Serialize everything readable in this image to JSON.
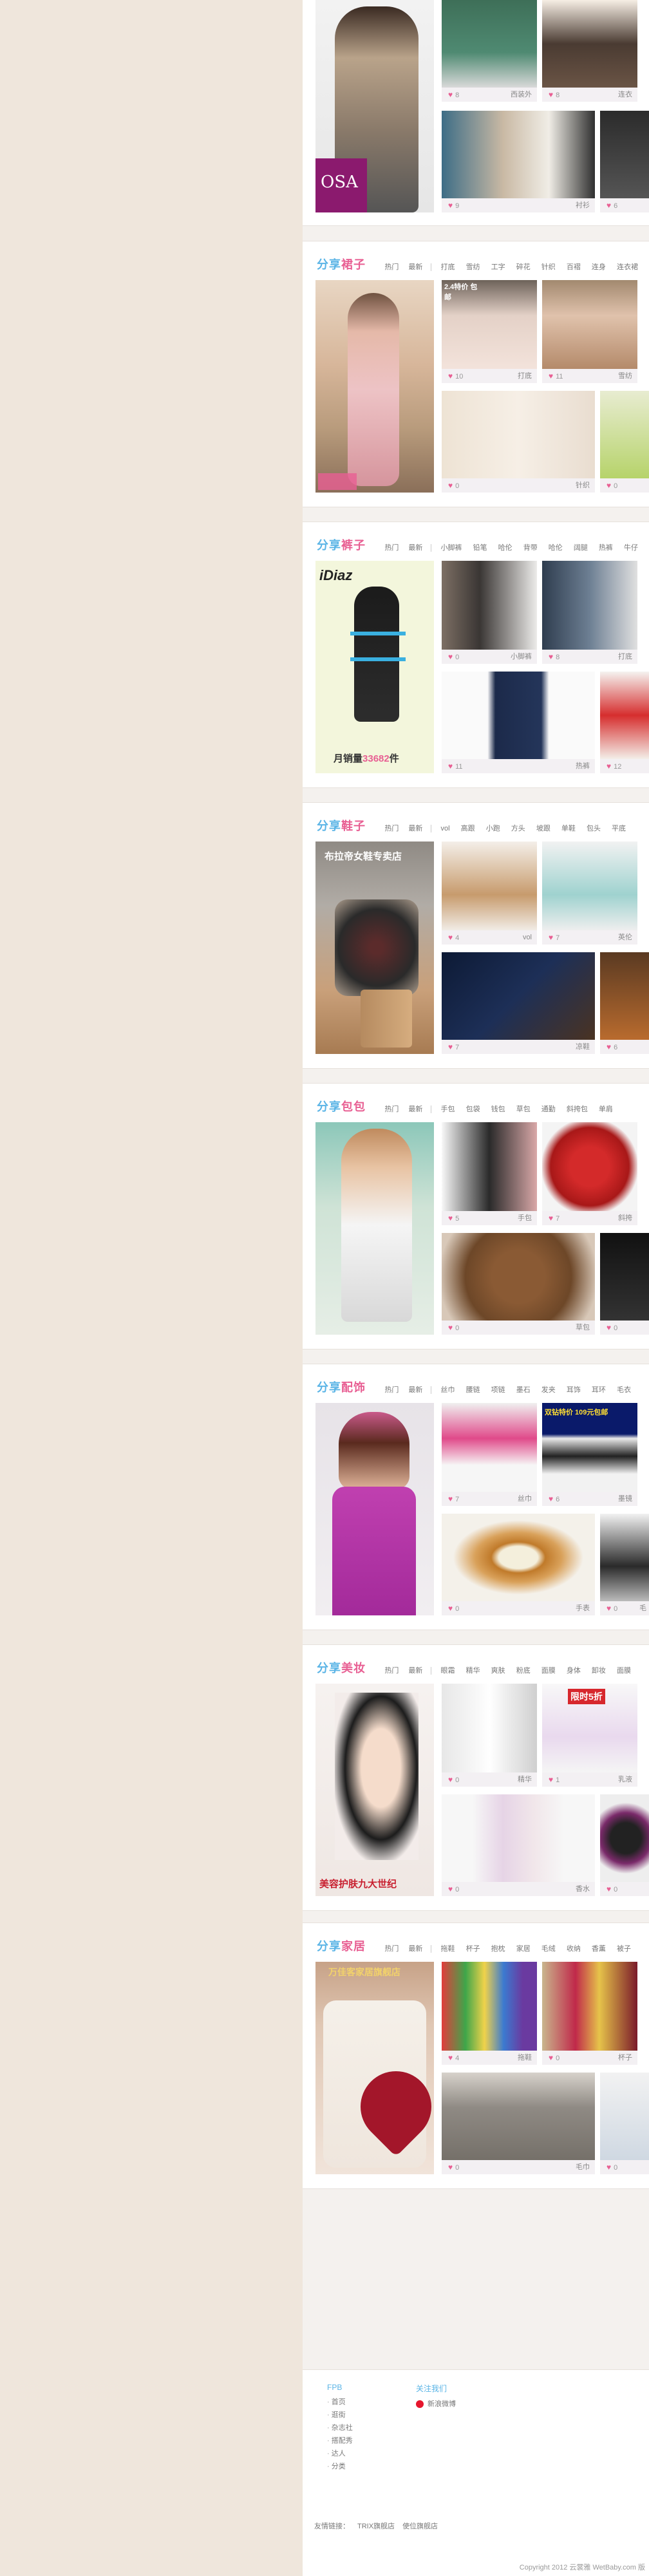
{
  "sections": [
    {
      "key": "top",
      "tiles": [
        {
          "count": "8",
          "tag": "西装外"
        },
        {
          "count": "8",
          "tag": "连衣"
        },
        {
          "count": "9",
          "tag": "衬衫"
        },
        {
          "count": "6",
          "tag": ""
        }
      ],
      "big_label": "OSA"
    },
    {
      "key": "skirt",
      "prefix": "分享",
      "category": "裙子",
      "tabs": [
        "热门",
        "最新"
      ],
      "sub": [
        "打底",
        "雪纺",
        "工字",
        "碎花",
        "针织",
        "百褶",
        "连身",
        "连衣裙"
      ],
      "promo": "2.4特价 包邮",
      "tiles": [
        {
          "count": "10",
          "tag": "打底"
        },
        {
          "count": "11",
          "tag": "雪纺"
        },
        {
          "count": "0",
          "tag": "针织"
        },
        {
          "count": "0",
          "tag": ""
        }
      ],
      "big_label": ""
    },
    {
      "key": "pants",
      "prefix": "分享",
      "category": "裤子",
      "tabs": [
        "热门",
        "最新"
      ],
      "sub": [
        "小脚裤",
        "铅笔",
        "哈伦",
        "背带",
        "哈伦",
        "阔腿",
        "热裤",
        "牛仔"
      ],
      "tiles": [
        {
          "count": "0",
          "tag": "小脚裤"
        },
        {
          "count": "8",
          "tag": "打底"
        },
        {
          "count": "11",
          "tag": "连衣"
        },
        {
          "count": "12",
          "tag": "热裤"
        }
      ],
      "big_brand": "iDiaz",
      "big_sales_prefix": "月销量",
      "big_sales_num": "33682",
      "big_sales_suffix": "件"
    },
    {
      "key": "shoes",
      "prefix": "分享",
      "category": "鞋子",
      "tabs": [
        "热门",
        "最新"
      ],
      "sub": [
        "vol",
        "高跟",
        "小跑",
        "方头",
        "坡跟",
        "单鞋",
        "包头",
        "平底"
      ],
      "promo": "布拉帝女鞋专卖店",
      "tiles": [
        {
          "count": "4",
          "tag": "vol"
        },
        {
          "count": "7",
          "tag": "英伦"
        },
        {
          "count": "7",
          "tag": "凉鞋"
        },
        {
          "count": "6",
          "tag": ""
        }
      ]
    },
    {
      "key": "bags",
      "prefix": "分享",
      "category": "包包",
      "tabs": [
        "热门",
        "最新"
      ],
      "sub": [
        "手包",
        "包袋",
        "钱包",
        "草包",
        "通勤",
        "斜挎包",
        "单肩"
      ],
      "tiles": [
        {
          "count": "5",
          "tag": "手包"
        },
        {
          "count": "7",
          "tag": "斜挎"
        },
        {
          "count": "0",
          "tag": "草包"
        },
        {
          "count": "0",
          "tag": ""
        }
      ]
    },
    {
      "key": "accessories",
      "prefix": "分享",
      "category": "配饰",
      "tabs": [
        "热门",
        "最新"
      ],
      "sub": [
        "丝巾",
        "腰链",
        "项链",
        "墨石",
        "发夹",
        "耳饰",
        "耳环",
        "毛衣"
      ],
      "promo": "双钻特价 109元包邮",
      "tiles": [
        {
          "count": "7",
          "tag": "丝巾"
        },
        {
          "count": "6",
          "tag": "墨镜"
        },
        {
          "count": "0",
          "tag": "手表"
        },
        {
          "count": "0",
          "tag": "毛"
        }
      ]
    },
    {
      "key": "beauty",
      "prefix": "分享",
      "category": "美妆",
      "tabs": [
        "热门",
        "最新"
      ],
      "sub": [
        "眼霜",
        "精华",
        "爽肤",
        "粉底",
        "面膜",
        "身体",
        "卸妆",
        "面膜",
        "彩妆"
      ],
      "promo": "限时5折",
      "tiles": [
        {
          "count": "0",
          "tag": "精华"
        },
        {
          "count": "1",
          "tag": "乳液"
        },
        {
          "count": "0",
          "tag": "香水"
        },
        {
          "count": "0",
          "tag": ""
        }
      ],
      "big_caption": "美容护肤九大世纪"
    },
    {
      "key": "home",
      "prefix": "分享",
      "category": "家居",
      "tabs": [
        "热门",
        "最新"
      ],
      "sub": [
        "拖鞋",
        "杯子",
        "抱枕",
        "家居",
        "毛绒",
        "收纳",
        "香薰",
        "被子"
      ],
      "promo": "万佳客家居旗舰店",
      "tiles": [
        {
          "count": "4",
          "tag": "拖鞋"
        },
        {
          "count": "0",
          "tag": "杯子"
        },
        {
          "count": "0",
          "tag": "毛巾"
        },
        {
          "count": "0",
          "tag": ""
        }
      ]
    }
  ],
  "footer": {
    "col1_title": "FPB",
    "col1_items": [
      "首页",
      "逛街",
      "杂志社",
      "搭配秀",
      "达人",
      "分类"
    ],
    "col2_title": "关注我们",
    "col2_items": [
      "新浪微博"
    ],
    "links_label": "友情链接：",
    "links": [
      "TRIX旗舰店",
      "使位旗舰店"
    ],
    "copyright": "Copyright 2012 云裳雅 WetBaby.com 版"
  }
}
